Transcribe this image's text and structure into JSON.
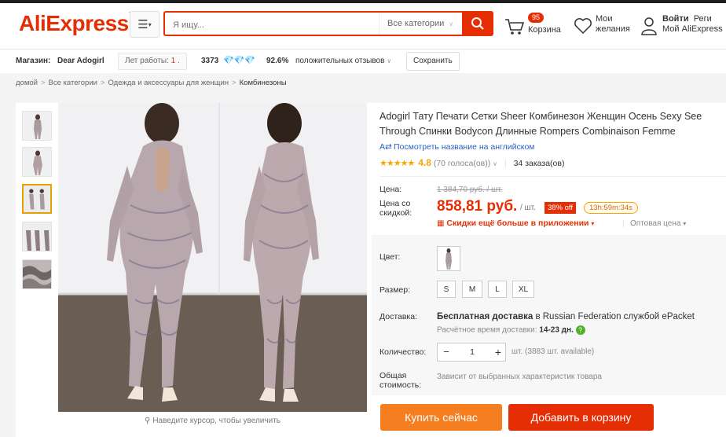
{
  "header": {
    "logo": "AliExpress",
    "search_placeholder": "Я ищу...",
    "search_category": "Все категории",
    "cart_count": "95",
    "cart_label": "Корзина",
    "wishlist_line1": "Мои",
    "wishlist_line2": "желания",
    "account_line1_a": "Войти",
    "account_line1_b": "Реги",
    "account_line2": "Мой AliExpress"
  },
  "store": {
    "label": "Магазин:",
    "name": "Dear Adogirl",
    "years_label": "Лет работы:",
    "years_value": "1",
    "score": "3373",
    "feedback_percent": "92.6%",
    "feedback_label": "положительных отзывов",
    "save_label": "Сохранить"
  },
  "breadcrumb": [
    "домой",
    "Все категории",
    "Одежда и аксессуары для женщин",
    "Комбинезоны"
  ],
  "gallery": {
    "zoom_hint": "Наведите курсор, чтобы увеличить"
  },
  "product": {
    "title": "Adogirl Тату Печати Сетки Sheer Комбинезон Женщин Осень Sexy See Through Спинки Bodycon Длинные Rompers Combinaison Femme",
    "translate_label": "Посмотреть название на английском",
    "rating": "4.8",
    "votes": "(70 голоса(ов))",
    "orders": "34 заказа(ов)",
    "price_label": "Цена:",
    "old_price": "1 384,70 руб. / шт.",
    "discount_label_1": "Цена со",
    "discount_label_2": "скидкой:",
    "price": "858,81 руб.",
    "per_unit": "/ шт.",
    "discount": "38% off",
    "timer": "13h:59m:34s",
    "app_deal": "Скидки ещё больше в приложении",
    "wholesale": "Оптовая цена",
    "color_label": "Цвет:",
    "size_label": "Размер:",
    "sizes": [
      "S",
      "M",
      "L",
      "XL"
    ],
    "shipping_label": "Доставка:",
    "shipping_bold": "Бесплатная доставка",
    "shipping_rest": " в Russian Federation службой ePacket",
    "delivery_time_label": "Расчётное время доставки:",
    "delivery_time": "14-23 дн.",
    "quantity_label": "Количество:",
    "quantity": "1",
    "available": "шт. (3883 шт. available)",
    "total_label_1": "Общая",
    "total_label_2": "стоимость:",
    "total_note": "Зависит от выбранных характеристик товара",
    "buy_now": "Купить сейчас",
    "add_to_cart": "Добавить в корзину"
  },
  "colors": {
    "brand": "#e62e04",
    "buy_button": "#f47e20",
    "stars": "#f7a700",
    "link": "#2b5ec7"
  }
}
